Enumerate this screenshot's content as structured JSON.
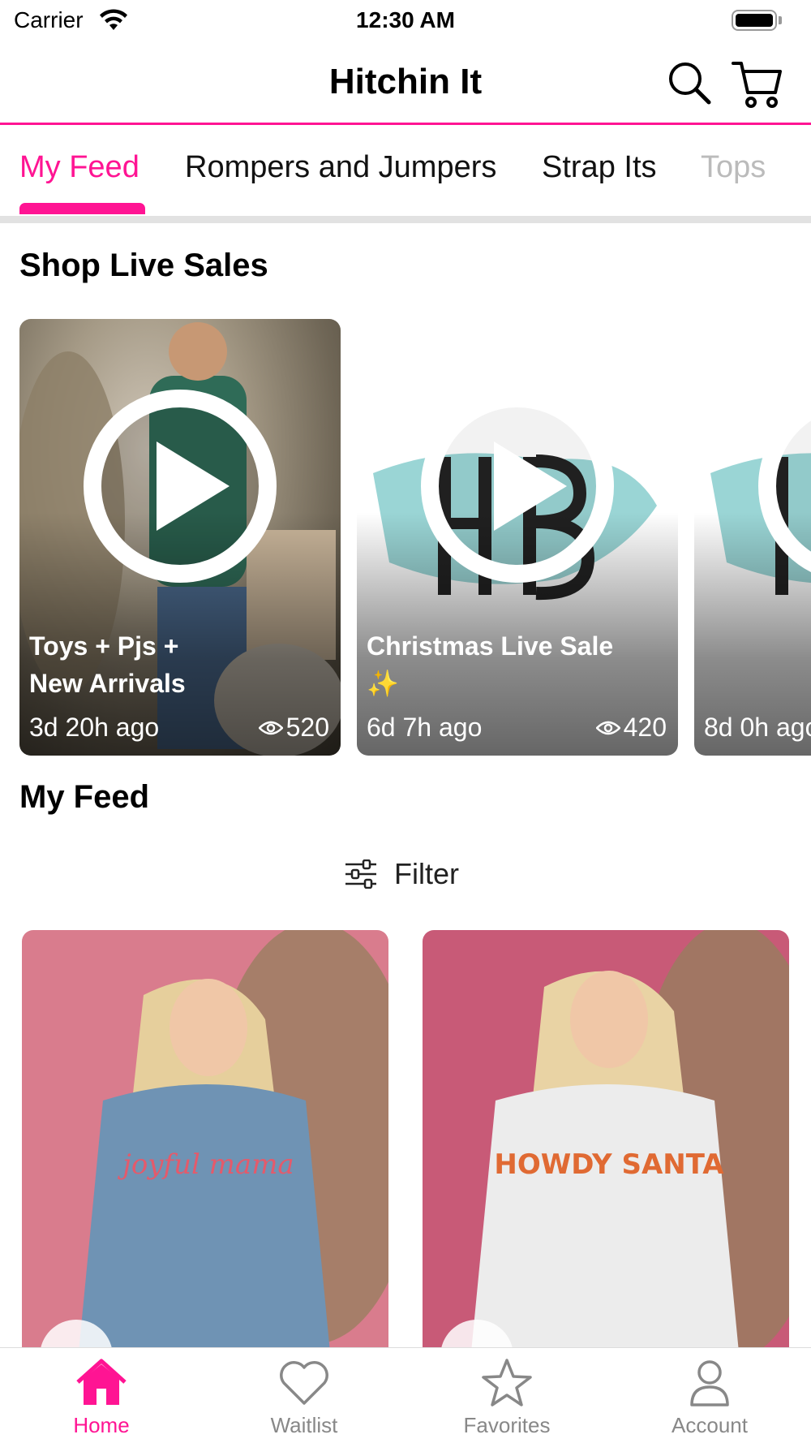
{
  "status_bar": {
    "carrier": "Carrier",
    "time": "12:30 AM"
  },
  "header": {
    "title": "Hitchin It",
    "search_icon": "search-icon",
    "cart_icon": "cart-icon"
  },
  "tabs": [
    {
      "label": "My Feed",
      "active": true
    },
    {
      "label": "Rompers and Jumpers"
    },
    {
      "label": "Strap Its"
    },
    {
      "label": "Tops"
    }
  ],
  "live_sales": {
    "heading": "Shop Live Sales",
    "cards": [
      {
        "title_line1": "Toys + Pjs +",
        "title_line2": "New Arrivals",
        "age": "3d 20h ago",
        "views": "520"
      },
      {
        "title_line1": "Christmas Live Sale",
        "title_line2": "✨",
        "age": "6d 7h ago",
        "views": "420"
      },
      {
        "title_line1": "",
        "title_line2": "",
        "age": "8d 0h ago",
        "views": ""
      }
    ]
  },
  "feed": {
    "heading": "My Feed",
    "filter_label": "Filter"
  },
  "products": [
    {
      "shirt_text": "joyful mama"
    },
    {
      "shirt_text": "HOWDY SANTA"
    }
  ],
  "bottom_nav": [
    {
      "label": "Home",
      "active": true
    },
    {
      "label": "Waitlist"
    },
    {
      "label": "Favorites"
    },
    {
      "label": "Account"
    }
  ],
  "colors": {
    "accent": "#ff1493",
    "inactive": "#888888"
  }
}
